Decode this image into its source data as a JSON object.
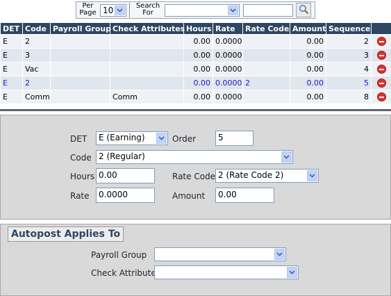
{
  "filter": {
    "per_page_label": "Per Page",
    "per_page_value": "10",
    "search_for_label": "Search For",
    "search_field_value": "",
    "search_text_value": ""
  },
  "grid": {
    "headers": [
      "DET",
      "Code",
      "Payroll Group",
      "Check Attributes",
      "Hours",
      "Rate",
      "Rate Code",
      "Amount",
      "Sequence"
    ],
    "rows": [
      {
        "det": "E",
        "code": "2",
        "payroll_group": "",
        "check_attributes": "",
        "hours": "0.00",
        "rate": "0.0000",
        "rate_code": "",
        "amount": "0.00",
        "sequence": "2"
      },
      {
        "det": "E",
        "code": "3",
        "payroll_group": "",
        "check_attributes": "",
        "hours": "0.00",
        "rate": "0.0000",
        "rate_code": "",
        "amount": "0.00",
        "sequence": "3"
      },
      {
        "det": "E",
        "code": "Vac",
        "payroll_group": "",
        "check_attributes": "",
        "hours": "0.00",
        "rate": "0.0000",
        "rate_code": "",
        "amount": "0.00",
        "sequence": "4"
      },
      {
        "det": "E",
        "code": "2",
        "payroll_group": "",
        "check_attributes": "",
        "hours": "0.00",
        "rate": "0.0000",
        "rate_code": "2",
        "amount": "0.00",
        "sequence": "5"
      },
      {
        "det": "E",
        "code": "Comm.",
        "payroll_group": "",
        "check_attributes": "Comm",
        "hours": "0.00",
        "rate": "0.0000",
        "rate_code": "",
        "amount": "0.00",
        "sequence": "8"
      }
    ]
  },
  "detail": {
    "det_label": "DET",
    "det_value": "E (Earning)",
    "order_label": "Order",
    "order_value": "5",
    "code_label": "Code",
    "code_value": "2 (Regular)",
    "hours_label": "Hours",
    "hours_value": "0.00",
    "rate_code_label": "Rate Code",
    "rate_code_value": "2 (Rate Code 2)",
    "rate_label": "Rate",
    "rate_value": "0.0000",
    "amount_label": "Amount",
    "amount_value": "0.00"
  },
  "autopost": {
    "title": "Autopost Applies To",
    "payroll_group_label": "Payroll Group",
    "payroll_group_value": "",
    "check_attribute_label": "Check Attribute",
    "check_attribute_value": ""
  },
  "icons": {
    "search": "magnifier-icon",
    "delete": "delete-minus-icon",
    "dropdown": "chevron-down-icon"
  },
  "colors": {
    "header_bg": "#2d4662",
    "panel_bg": "#d9d9d9",
    "delete_red": "#d9342b",
    "selected_row_text": "#1a1ac8"
  }
}
